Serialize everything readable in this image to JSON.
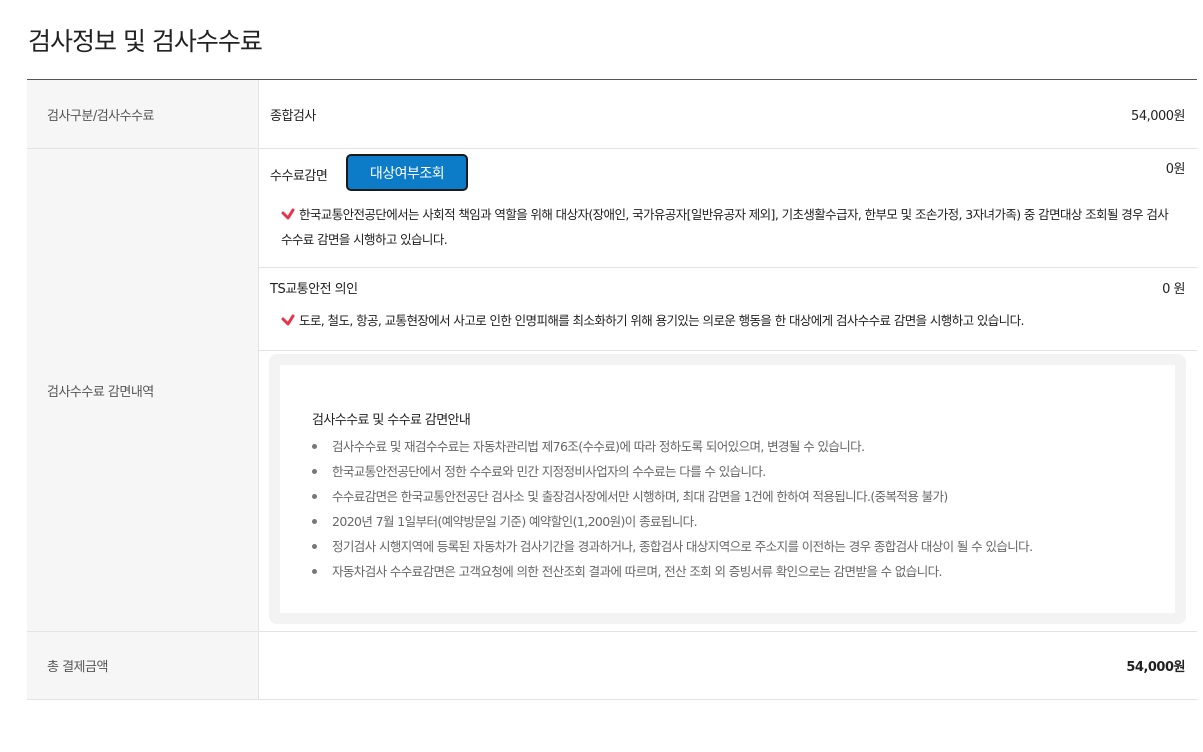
{
  "page": {
    "title": "검사정보 및 검사수수료"
  },
  "rows": {
    "category": {
      "label": "검사구분/검사수수료",
      "type": "종합검사",
      "amount": "54,000원"
    },
    "discount": {
      "label": "검사수수료 감면내역",
      "fee_reduction": {
        "label": "수수료감면",
        "button": "대상여부조회",
        "amount": "0원",
        "note": "한국교통안전공단에서는 사회적 책임과 역할을 위해 대상자(장애인, 국가유공자[일반유공자 제외], 기초생활수급자, 한부모 및 조손가정, 3자녀가족) 중 감면대상 조회될 경우 검사수수료 감면을 시행하고 있습니다."
      },
      "ts_righteous": {
        "label": "TS교통안전 의인",
        "amount": "0 원",
        "note": "도로, 철도, 항공, 교통현장에서 사고로 인한 인명피해를 최소화하기 위해 용기있는 의로운 행동을 한 대상에게 검사수수료 감면을 시행하고 있습니다."
      },
      "info": {
        "title": "검사수수료 및 수수료 감면안내",
        "items": [
          "검사수수료 및 재검수수료는 자동차관리법 제76조(수수료)에 따라 정하도록 되어있으며, 변경될 수 있습니다.",
          "한국교통안전공단에서 정한 수수료와 민간 지정정비사업자의 수수료는 다를 수 있습니다.",
          "수수료감면은 한국교통안전공단 검사소 및 출장검사장에서만 시행하며, 최대 감면을 1건에 한하여 적용됩니다.(중복적용 불가)",
          "2020년 7월 1일부터(예약방문일 기준) 예약할인(1,200원)이 종료됩니다.",
          "정기검사 시행지역에 등록된 자동차가 검사기간을 경과하거나, 종합검사 대상지역으로 주소지를 이전하는 경우 종합검사 대상이 될 수 있습니다.",
          "자동차검사 수수료감면은 고객요청에 의한 전산조회 결과에 따르며, 전산 조회 외 증빙서류 확인으로는 감면받을 수 없습니다."
        ]
      }
    },
    "total": {
      "label": "총 결제금액",
      "amount": "54,000원"
    }
  },
  "colors": {
    "button_bg": "#0c7bc8",
    "check_icon": "#e8334a"
  }
}
